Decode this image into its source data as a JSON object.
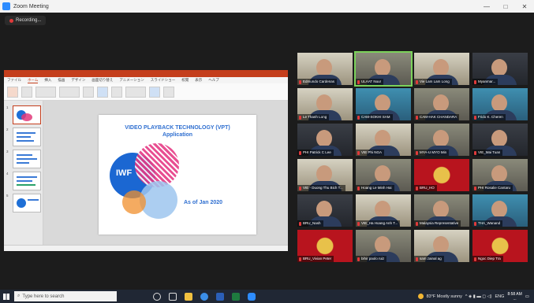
{
  "window": {
    "title": "Zoom Meeting",
    "controls": [
      "—",
      "□",
      "✕"
    ]
  },
  "recording": {
    "label": "Recording..."
  },
  "share": {
    "app_tabs": [
      "ファイル",
      "ホーム",
      "挿入",
      "描画",
      "デザイン",
      "画面切り替え",
      "アニメーション",
      "スライドショー",
      "校閲",
      "表示",
      "ヘルプ"
    ],
    "slide": {
      "title_line1": "VIDEO PLAYBACK TECHNOLOGY (VPT)",
      "title_line2": "Application",
      "logo_text": "IWF",
      "as_of": "As of Jan 2020"
    },
    "thumb_numbers": [
      "1",
      "2",
      "3",
      "4",
      "5"
    ]
  },
  "participants": [
    {
      "name": "Edmundo Cardenas"
    },
    {
      "name": "ULAAT Nuur"
    },
    {
      "name": "Vie Lam Lam Long"
    },
    {
      "name": "Myanmar..."
    },
    {
      "name": "Le Thanh Long"
    },
    {
      "name": "CAM-SOKHI SAM"
    },
    {
      "name": "CAM-HAK CHANDARA"
    },
    {
      "name": "Frido K. Cheren"
    },
    {
      "name": "PHI Patrick C Lee"
    },
    {
      "name": "VIE Phi NGA"
    },
    {
      "name": "MYA-U MYO Min"
    },
    {
      "name": "VIE_Mai Tuan"
    },
    {
      "name": "VIE - Duong Thu Bich T..."
    },
    {
      "name": "Hoang Le Minh Hai"
    },
    {
      "name": "BRU_HO"
    },
    {
      "name": "PHI Rosalie Cantaru"
    },
    {
      "name": "BRU_Nash"
    },
    {
      "name": "VIE_Ha Hoang Anh T..."
    },
    {
      "name": "Malaysia Representative"
    },
    {
      "name": "THA_Wanand"
    },
    {
      "name": "BRU_Vivian Peter"
    },
    {
      "name": "bihir paolo ruiz"
    },
    {
      "name": "sam zainal ag"
    },
    {
      "name": "Ngoc Diep Tra"
    }
  ],
  "taskbar": {
    "search_placeholder": "Type here to search",
    "weather": "83°F  Mostly sunny",
    "lang": "ENG",
    "time": "8:58 AM",
    "date": "..."
  }
}
